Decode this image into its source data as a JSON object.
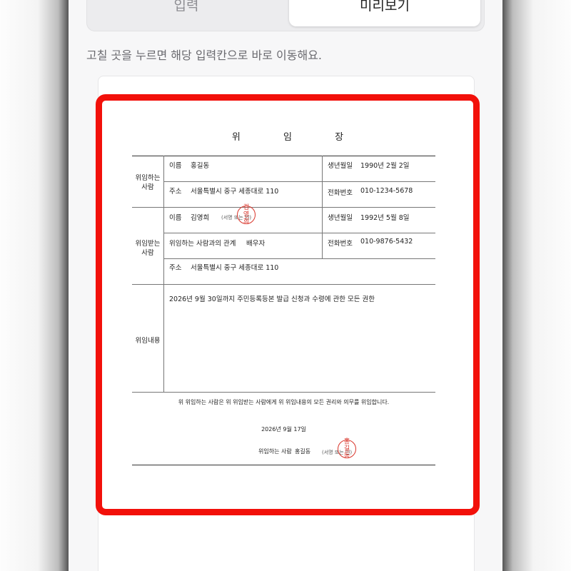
{
  "tabs": {
    "input": "입력",
    "preview": "미리보기"
  },
  "hint": "고칠 곳을 누르면 해당 입력칸으로 바로 이동해요.",
  "document": {
    "title": "위 임 장",
    "grantor": {
      "section_label_1": "위임하는",
      "section_label_2": "사람",
      "name_label": "이름",
      "name": "홍길동",
      "birth_label": "생년월일",
      "birth": "1990년 2월 2일",
      "address_label": "주소",
      "address": "서울특별시 중구 세종대로 110",
      "phone_label": "전화번호",
      "phone": "010-1234-5678"
    },
    "grantee": {
      "section_label_1": "위임받는",
      "section_label_2": "사람",
      "name_label": "이름",
      "name": "김영희",
      "sign_label": "(서명 또는 인)",
      "seal_text": "김영희",
      "birth_label": "생년월일",
      "birth": "1992년 5월 8일",
      "relation_label": "위임하는 사람과의 관계",
      "relation": "배우자",
      "phone_label": "전화번호",
      "phone": "010-9876-5432",
      "address_label": "주소",
      "address": "서울특별시 중구 세종대로 110"
    },
    "content": {
      "label": "위임내용",
      "text": "2026년 9월 30일까지 주민등록등본 발급 신청과 수령에 관한 모든 권한"
    },
    "statement": "위 위임하는 사람은 위 위임받는 사람에게 위 위임내용의 모든 권리와 의무를 위임합니다.",
    "date": "2026년 9월 17일",
    "signer_label": "위임하는 사람",
    "signer_name": "홍길동",
    "signer_sign_label": "(서명 또는 인)",
    "signer_seal_text": "홍길동"
  },
  "colors": {
    "highlight": "#f2100a",
    "seal": "#d9362c"
  }
}
